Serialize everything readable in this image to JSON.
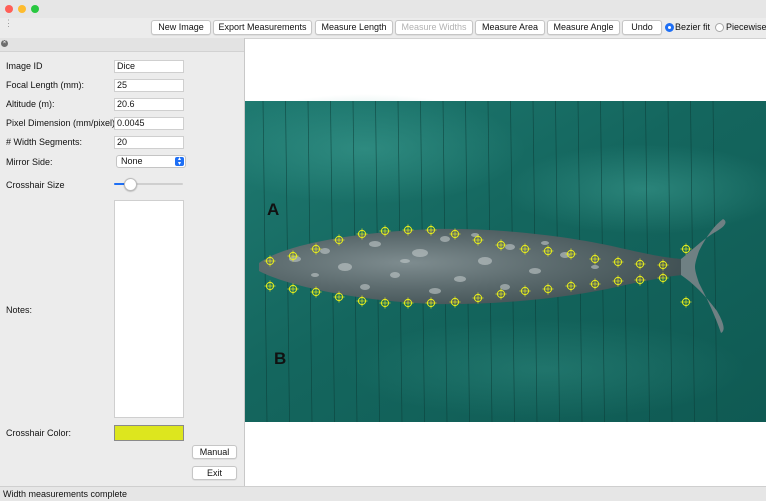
{
  "window": {
    "status": "Width measurements complete"
  },
  "toolbar": {
    "buttons": [
      "New Image",
      "Export Measurements",
      "Measure Length",
      "Measure Widths",
      "Measure Area",
      "Measure Angle",
      "Undo"
    ],
    "disabled_button": "Measure Widths",
    "curve_options": [
      "Bezier fit",
      "Piecewise"
    ],
    "selected_curve": "Bezier fit"
  },
  "sidebar": {
    "image_id_label": "Image ID",
    "image_id_value": "Dice",
    "focal_label": "Focal Length (mm):",
    "focal_value": "25",
    "altitude_label": "Altitude (m):",
    "altitude_value": "20.6",
    "pixel_label": "Pixel Dimension (mm/pixel)",
    "pixel_value": "0.0045",
    "width_label": "# Width Segments:",
    "width_value": "20",
    "mirror_label": "Mirror Side:",
    "mirror_value": "None",
    "crosshair_size_label": "Crosshair Size",
    "crosshair_size_fraction": 0.23,
    "notes_label": "Notes:",
    "notes_value": "",
    "crosshair_color_label": "Crosshair Color:",
    "crosshair_color": "#dde61e",
    "manual_label": "Manual",
    "exit_label": "Exit"
  },
  "canvas": {
    "label_a": "A",
    "label_b": "B",
    "crosshair_color": "#e8ee1a"
  }
}
